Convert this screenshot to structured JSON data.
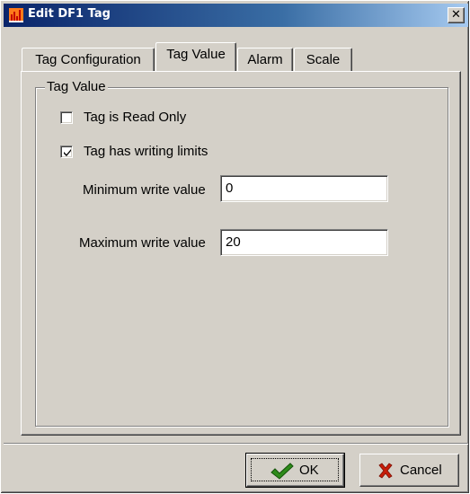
{
  "window": {
    "title": "Edit DF1 Tag",
    "close_glyph": "✕",
    "icon": "bar-chart-icon"
  },
  "tabs": [
    {
      "label": "Tag Configuration",
      "active": false
    },
    {
      "label": "Tag Value",
      "active": true
    },
    {
      "label": "Alarm",
      "active": false
    },
    {
      "label": "Scale",
      "active": false
    }
  ],
  "panel": {
    "group_title": "Tag Value",
    "read_only": {
      "label": "Tag is Read Only",
      "checked": false
    },
    "writing_limits": {
      "label": "Tag has writing limits",
      "checked": true
    },
    "min_write": {
      "label": "Minimum write value",
      "value": "0"
    },
    "max_write": {
      "label": "Maximum write value",
      "value": "20"
    }
  },
  "buttons": {
    "ok": {
      "label": "OK",
      "icon": "check-icon",
      "color": "#2e8b1a"
    },
    "cancel": {
      "label": "Cancel",
      "icon": "x-icon",
      "color": "#c81e0a"
    }
  },
  "colors": {
    "face": "#d4d0c8",
    "title_start": "#0a246a",
    "title_end": "#a6caf0"
  }
}
